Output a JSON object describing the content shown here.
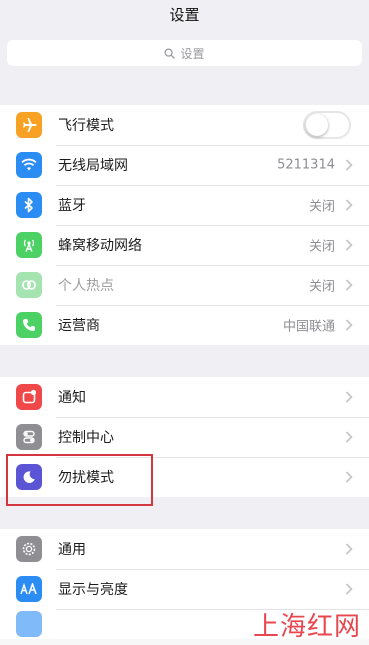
{
  "nav": {
    "title": "设置"
  },
  "search": {
    "placeholder": "设置",
    "icon": "search-icon"
  },
  "group1": [
    {
      "id": "airplane",
      "label": "飞行模式",
      "icon": "airplane-icon",
      "color": "#f7a224",
      "control": "toggle",
      "toggle_on": false
    },
    {
      "id": "wifi",
      "label": "无线局域网",
      "icon": "wifi-icon",
      "color": "#2b8cf3",
      "value": "5211314"
    },
    {
      "id": "bluetooth",
      "label": "蓝牙",
      "icon": "bluetooth-icon",
      "color": "#2b8cf3",
      "value": "关闭"
    },
    {
      "id": "cellular",
      "label": "蜂窝移动网络",
      "icon": "cellular-icon",
      "color": "#4cd264",
      "value": "关闭"
    },
    {
      "id": "hotspot",
      "label": "个人热点",
      "icon": "hotspot-icon",
      "color": "#a5e3b0",
      "value": "关闭",
      "disabled": true
    },
    {
      "id": "carrier",
      "label": "运营商",
      "icon": "phone-icon",
      "color": "#4cd264",
      "value": "中国联通"
    }
  ],
  "group2": [
    {
      "id": "notifications",
      "label": "通知",
      "icon": "notifications-icon",
      "color": "#f04848"
    },
    {
      "id": "control-center",
      "label": "控制中心",
      "icon": "control-center-icon",
      "color": "#8e8e93"
    },
    {
      "id": "dnd",
      "label": "勿扰模式",
      "icon": "moon-icon",
      "color": "#5b55d6",
      "highlighted": true
    }
  ],
  "group3": [
    {
      "id": "general",
      "label": "通用",
      "icon": "gear-icon",
      "color": "#8e8e93"
    },
    {
      "id": "display",
      "label": "显示与亮度",
      "icon": "display-icon",
      "color": "#2b8cf3"
    }
  ],
  "watermark": "上海红网"
}
